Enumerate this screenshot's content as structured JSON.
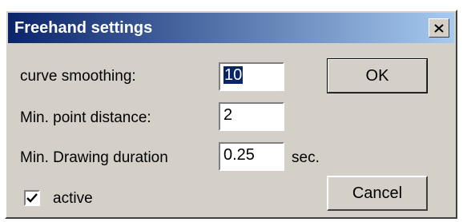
{
  "window": {
    "title": "Freehand settings",
    "close_icon": "close-icon"
  },
  "fields": {
    "curve_smoothing": {
      "label": "curve smoothing:",
      "value": "10",
      "selected": true
    },
    "min_point_distance": {
      "label": "Min. point distance:",
      "value": "2"
    },
    "min_drawing_duration": {
      "label": "Min. Drawing duration",
      "value": "0.25",
      "unit": "sec."
    }
  },
  "active": {
    "label": "active",
    "checked": true
  },
  "buttons": {
    "ok": "OK",
    "cancel": "Cancel"
  },
  "colors": {
    "face": "#d4d0c8",
    "title_start": "#0a246a",
    "title_end": "#a6caf0",
    "selection": "#0a246a"
  }
}
